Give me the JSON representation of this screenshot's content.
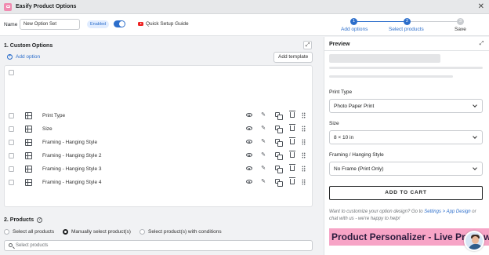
{
  "window": {
    "title": "Easify Product Options"
  },
  "toolbar": {
    "name_label": "Name",
    "name_value": "New Option Set",
    "enabled_label": "Enabled",
    "quick_setup_label": "Quick Setup Guide"
  },
  "steps": [
    {
      "number": "1",
      "label": "Add options",
      "state": "done"
    },
    {
      "number": "2",
      "label": "Select products",
      "state": "active"
    },
    {
      "number": "3",
      "label": "Save",
      "state": "pending"
    }
  ],
  "custom_options": {
    "title": "1. Custom Options",
    "add_option_label": "Add option",
    "add_template_label": "Add template",
    "items": [
      {
        "name": "Print Type"
      },
      {
        "name": "Size"
      },
      {
        "name": "Framing - Hanging Style"
      },
      {
        "name": "Framing - Hanging Style 2"
      },
      {
        "name": "Framing - Hanging Style 3"
      },
      {
        "name": "Framing - Hanging Style 4"
      }
    ]
  },
  "products": {
    "title": "2. Products",
    "radio_options": [
      {
        "label": "Select all products",
        "selected": false
      },
      {
        "label": "Manually select product(s)",
        "selected": true
      },
      {
        "label": "Select product(s) with conditions",
        "selected": false
      }
    ],
    "search_placeholder": "Select products"
  },
  "preview": {
    "title": "Preview",
    "fields": [
      {
        "label": "Print Type",
        "value": "Photo Paper Print"
      },
      {
        "label": "Size",
        "value": "8 × 10 in"
      },
      {
        "label": "Framing / Hanging Style",
        "value": "No Frame (Print Only)"
      }
    ],
    "add_to_cart_label": "ADD TO CART",
    "note_text_1": "Want to customize your option design? Go to ",
    "note_link": "Settings > App Design",
    "note_text_2": " or chat with us - we're happy to help!",
    "banner_text": "Product Personalizer - Live Preview"
  },
  "colors": {
    "accent": "#2c6ecb",
    "banner": "#f7a4c6",
    "step_pending": "#c9ccd0"
  }
}
